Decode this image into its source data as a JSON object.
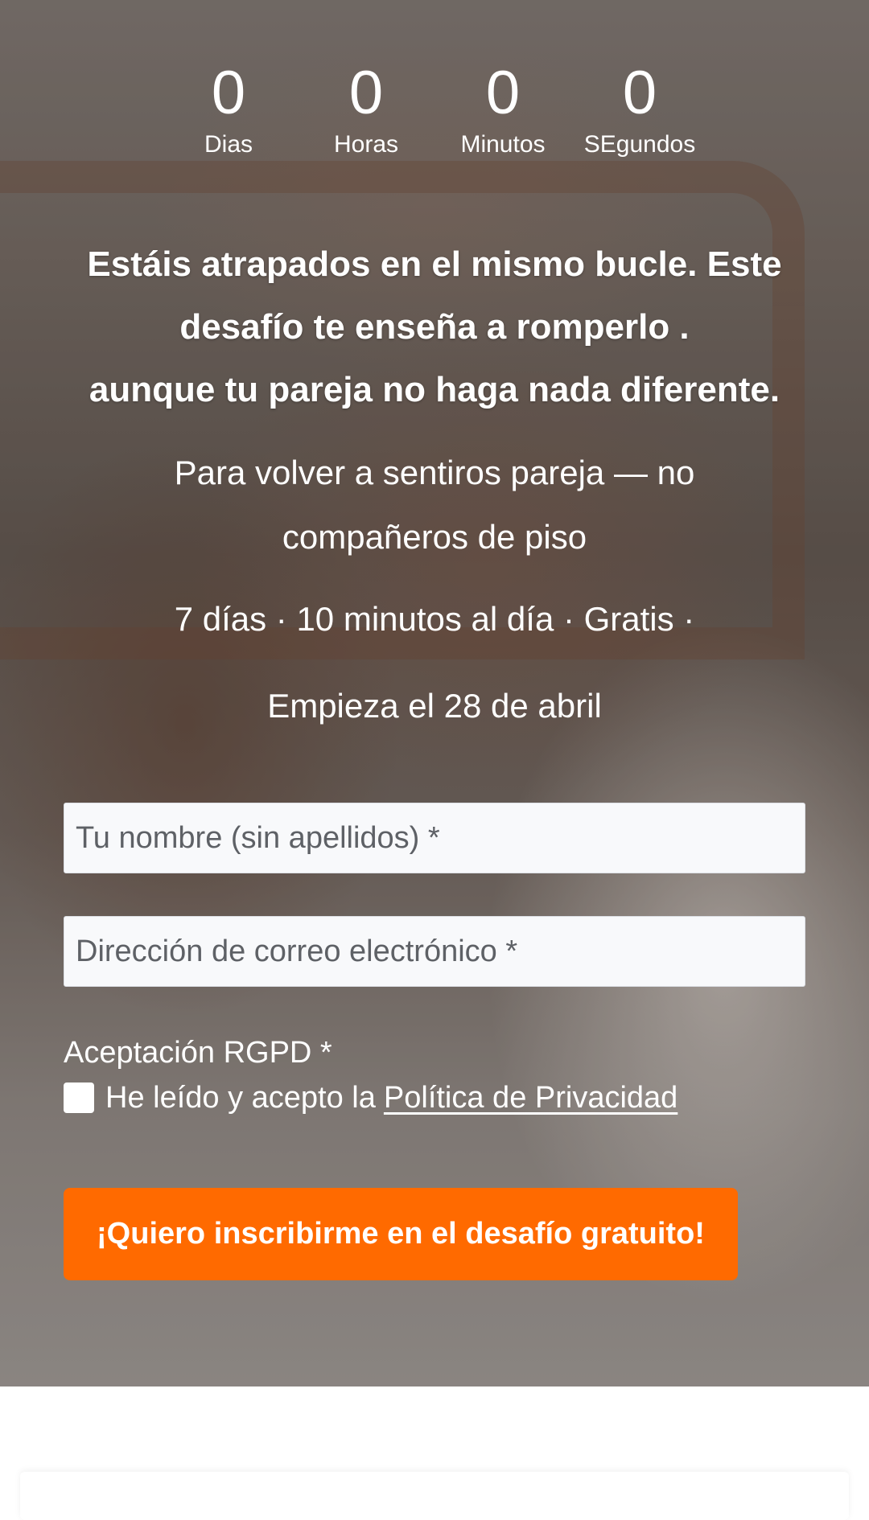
{
  "countdown": {
    "days": {
      "value": "0",
      "label": "Dias"
    },
    "hours": {
      "value": "0",
      "label": "Horas"
    },
    "minutes": {
      "value": "0",
      "label": "Minutos"
    },
    "seconds": {
      "value": "0",
      "label": "SEgundos"
    }
  },
  "headline": {
    "line1": "Estáis atrapados en el mismo bucle. Este",
    "line2": "desafío te enseña a romperlo .",
    "line3": "aunque tu pareja no haga nada diferente."
  },
  "subline": {
    "line1": "Para volver a sentiros pareja — no",
    "line2": "compañeros de piso"
  },
  "meta": "7 días · 10 minutos al día · Gratis ·",
  "start": "Empieza el 28 de abril",
  "form": {
    "name_placeholder": "Tu nombre (sin apellidos) *",
    "email_placeholder": "Dirección de correo electrónico *",
    "rgpd_label": "Aceptación RGPD *",
    "consent_text": "He leído y acepto la",
    "privacy_link": "Política de Privacidad",
    "submit_label": "¡Quiero inscribirme en el desafío gratuito!"
  },
  "colors": {
    "accent": "#ff6a00"
  }
}
